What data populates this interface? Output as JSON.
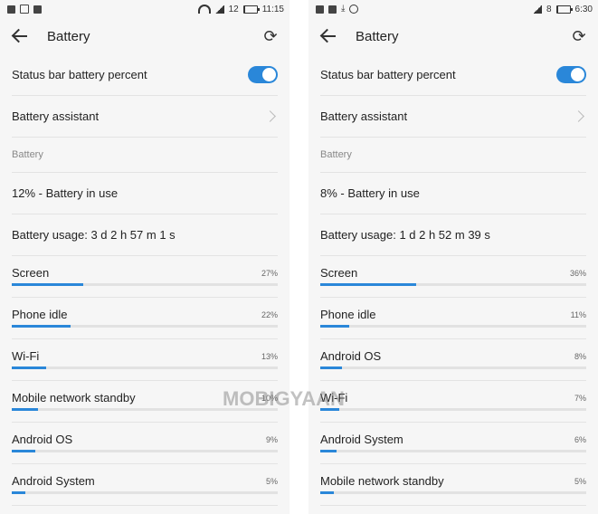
{
  "accent_color": "#2a87d9",
  "screens": [
    {
      "status": {
        "left_icons": [
          "image-icon",
          "square-icon",
          "gallery-icon"
        ],
        "right_icons": [
          "wifi-icon",
          "signal-icon"
        ],
        "signal_text": "12",
        "battery_level": 0.12,
        "time": "11:15"
      },
      "title": "Battery",
      "toggle_label": "Status bar battery percent",
      "toggle_on": true,
      "assistant_label": "Battery assistant",
      "section_label": "Battery",
      "battery_status": "12% - Battery in use",
      "usage_time": "Battery usage: 3 d 2 h 57 m 1 s",
      "items": [
        {
          "name": "Screen",
          "pct": "27%",
          "value": 27
        },
        {
          "name": "Phone idle",
          "pct": "22%",
          "value": 22
        },
        {
          "name": "Wi-Fi",
          "pct": "13%",
          "value": 13
        },
        {
          "name": "Mobile network standby",
          "pct": "10%",
          "value": 10
        },
        {
          "name": "Android OS",
          "pct": "9%",
          "value": 9
        },
        {
          "name": "Android System",
          "pct": "5%",
          "value": 5
        }
      ]
    },
    {
      "status": {
        "left_icons": [
          "image-icon",
          "gallery-icon",
          "download-icon",
          "circle-icon"
        ],
        "right_icons": [
          "signal-icon"
        ],
        "signal_text": "8",
        "battery_level": 0.08,
        "time": "6:30"
      },
      "title": "Battery",
      "toggle_label": "Status bar battery percent",
      "toggle_on": true,
      "assistant_label": "Battery assistant",
      "section_label": "Battery",
      "battery_status": "8% - Battery in use",
      "usage_time": "Battery usage: 1 d 2 h 52 m 39 s",
      "items": [
        {
          "name": "Screen",
          "pct": "36%",
          "value": 36
        },
        {
          "name": "Phone idle",
          "pct": "11%",
          "value": 11
        },
        {
          "name": "Android OS",
          "pct": "8%",
          "value": 8
        },
        {
          "name": "Wi-Fi",
          "pct": "7%",
          "value": 7
        },
        {
          "name": "Android System",
          "pct": "6%",
          "value": 6
        },
        {
          "name": "Mobile network standby",
          "pct": "5%",
          "value": 5
        }
      ]
    }
  ],
  "watermark": "MOBIGYAAN"
}
